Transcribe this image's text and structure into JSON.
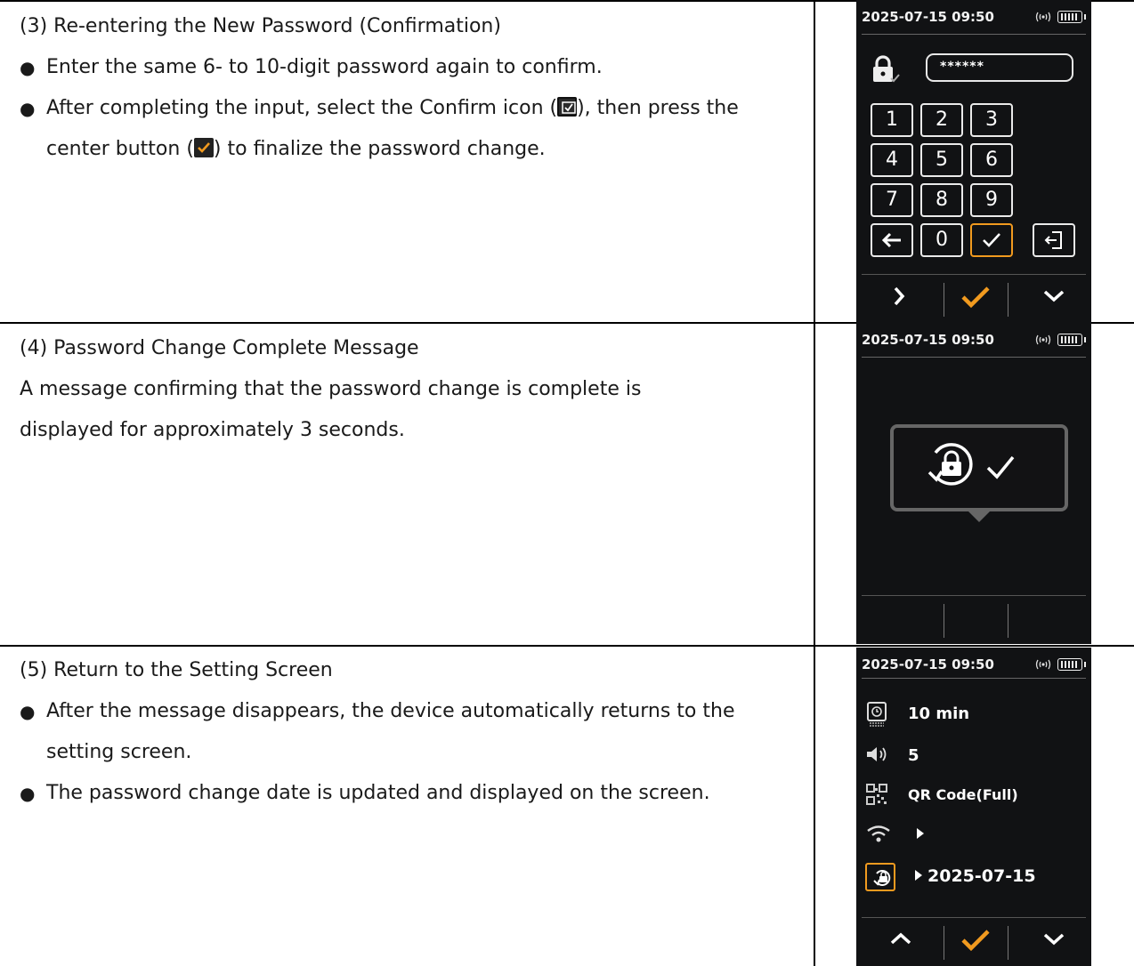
{
  "sections": [
    {
      "heading": "(3) Re-entering the New Password (Confirmation)",
      "bullet1": "Enter the same 6- to 10-digit password again to confirm.",
      "bullet2_a": "After completing the input, select the Confirm icon (",
      "bullet2_b": "), then press the center button (",
      "bullet2_c": ") to finalize the password change."
    },
    {
      "heading": "(4) Password Change Complete Message",
      "body": "A message confirming that the password change is complete is displayed for approximately 3 seconds."
    },
    {
      "heading": "(5) Return to the Setting Screen",
      "bullet1": "After the message disappears, the device automatically returns to the setting screen.",
      "bullet2": "The password change date is updated and displayed on the screen."
    }
  ],
  "device": {
    "status_time": "2025-07-15 09:50",
    "password_mask": "******",
    "keys": [
      "1",
      "2",
      "3",
      "4",
      "5",
      "6",
      "7",
      "8",
      "9",
      "0"
    ],
    "settings": {
      "timer": "10 min",
      "volume": "5",
      "qr_mode": "QR Code(Full)",
      "password_date": "2025-07-15"
    },
    "accent_color": "#f19a1f",
    "screen_bg": "#111214"
  },
  "icons": {
    "confirm_icon": "check-box-icon",
    "center_button": "orange-check-icon",
    "lock": "lock-check-icon",
    "password_reset": "lock-rotate-icon",
    "wifi": "wifi-icon",
    "qr": "qr-icon",
    "volume": "speaker-icon",
    "timer": "timer-icon"
  }
}
